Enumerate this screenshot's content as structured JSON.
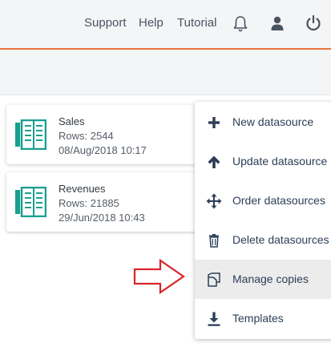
{
  "header": {
    "links": [
      "Support",
      "Help",
      "Tutorial"
    ],
    "icons": [
      "bell-icon",
      "user-icon",
      "power-icon"
    ]
  },
  "datasources": [
    {
      "name": "Sales",
      "rows": "Rows: 2544",
      "date": "08/Aug/2018 10:17"
    },
    {
      "name": "Revenues",
      "rows": "Rows: 21885",
      "date": "29/Jun/2018 10:43"
    }
  ],
  "menu": {
    "items": [
      {
        "label": "New datasource",
        "icon": "plus-icon"
      },
      {
        "label": "Update datasource",
        "icon": "arrow-up-icon"
      },
      {
        "label": "Order datasources",
        "icon": "move-icon"
      },
      {
        "label": "Delete datasources",
        "icon": "trash-icon"
      },
      {
        "label": "Manage copies",
        "icon": "copies-icon",
        "highlighted": true
      },
      {
        "label": "Templates",
        "icon": "download-icon"
      }
    ]
  },
  "colors": {
    "accent": "#e8743b",
    "icon_teal": "#1a9e8f",
    "menu_text": "#2c3e57",
    "pointer_arrow": "#d9262b"
  }
}
